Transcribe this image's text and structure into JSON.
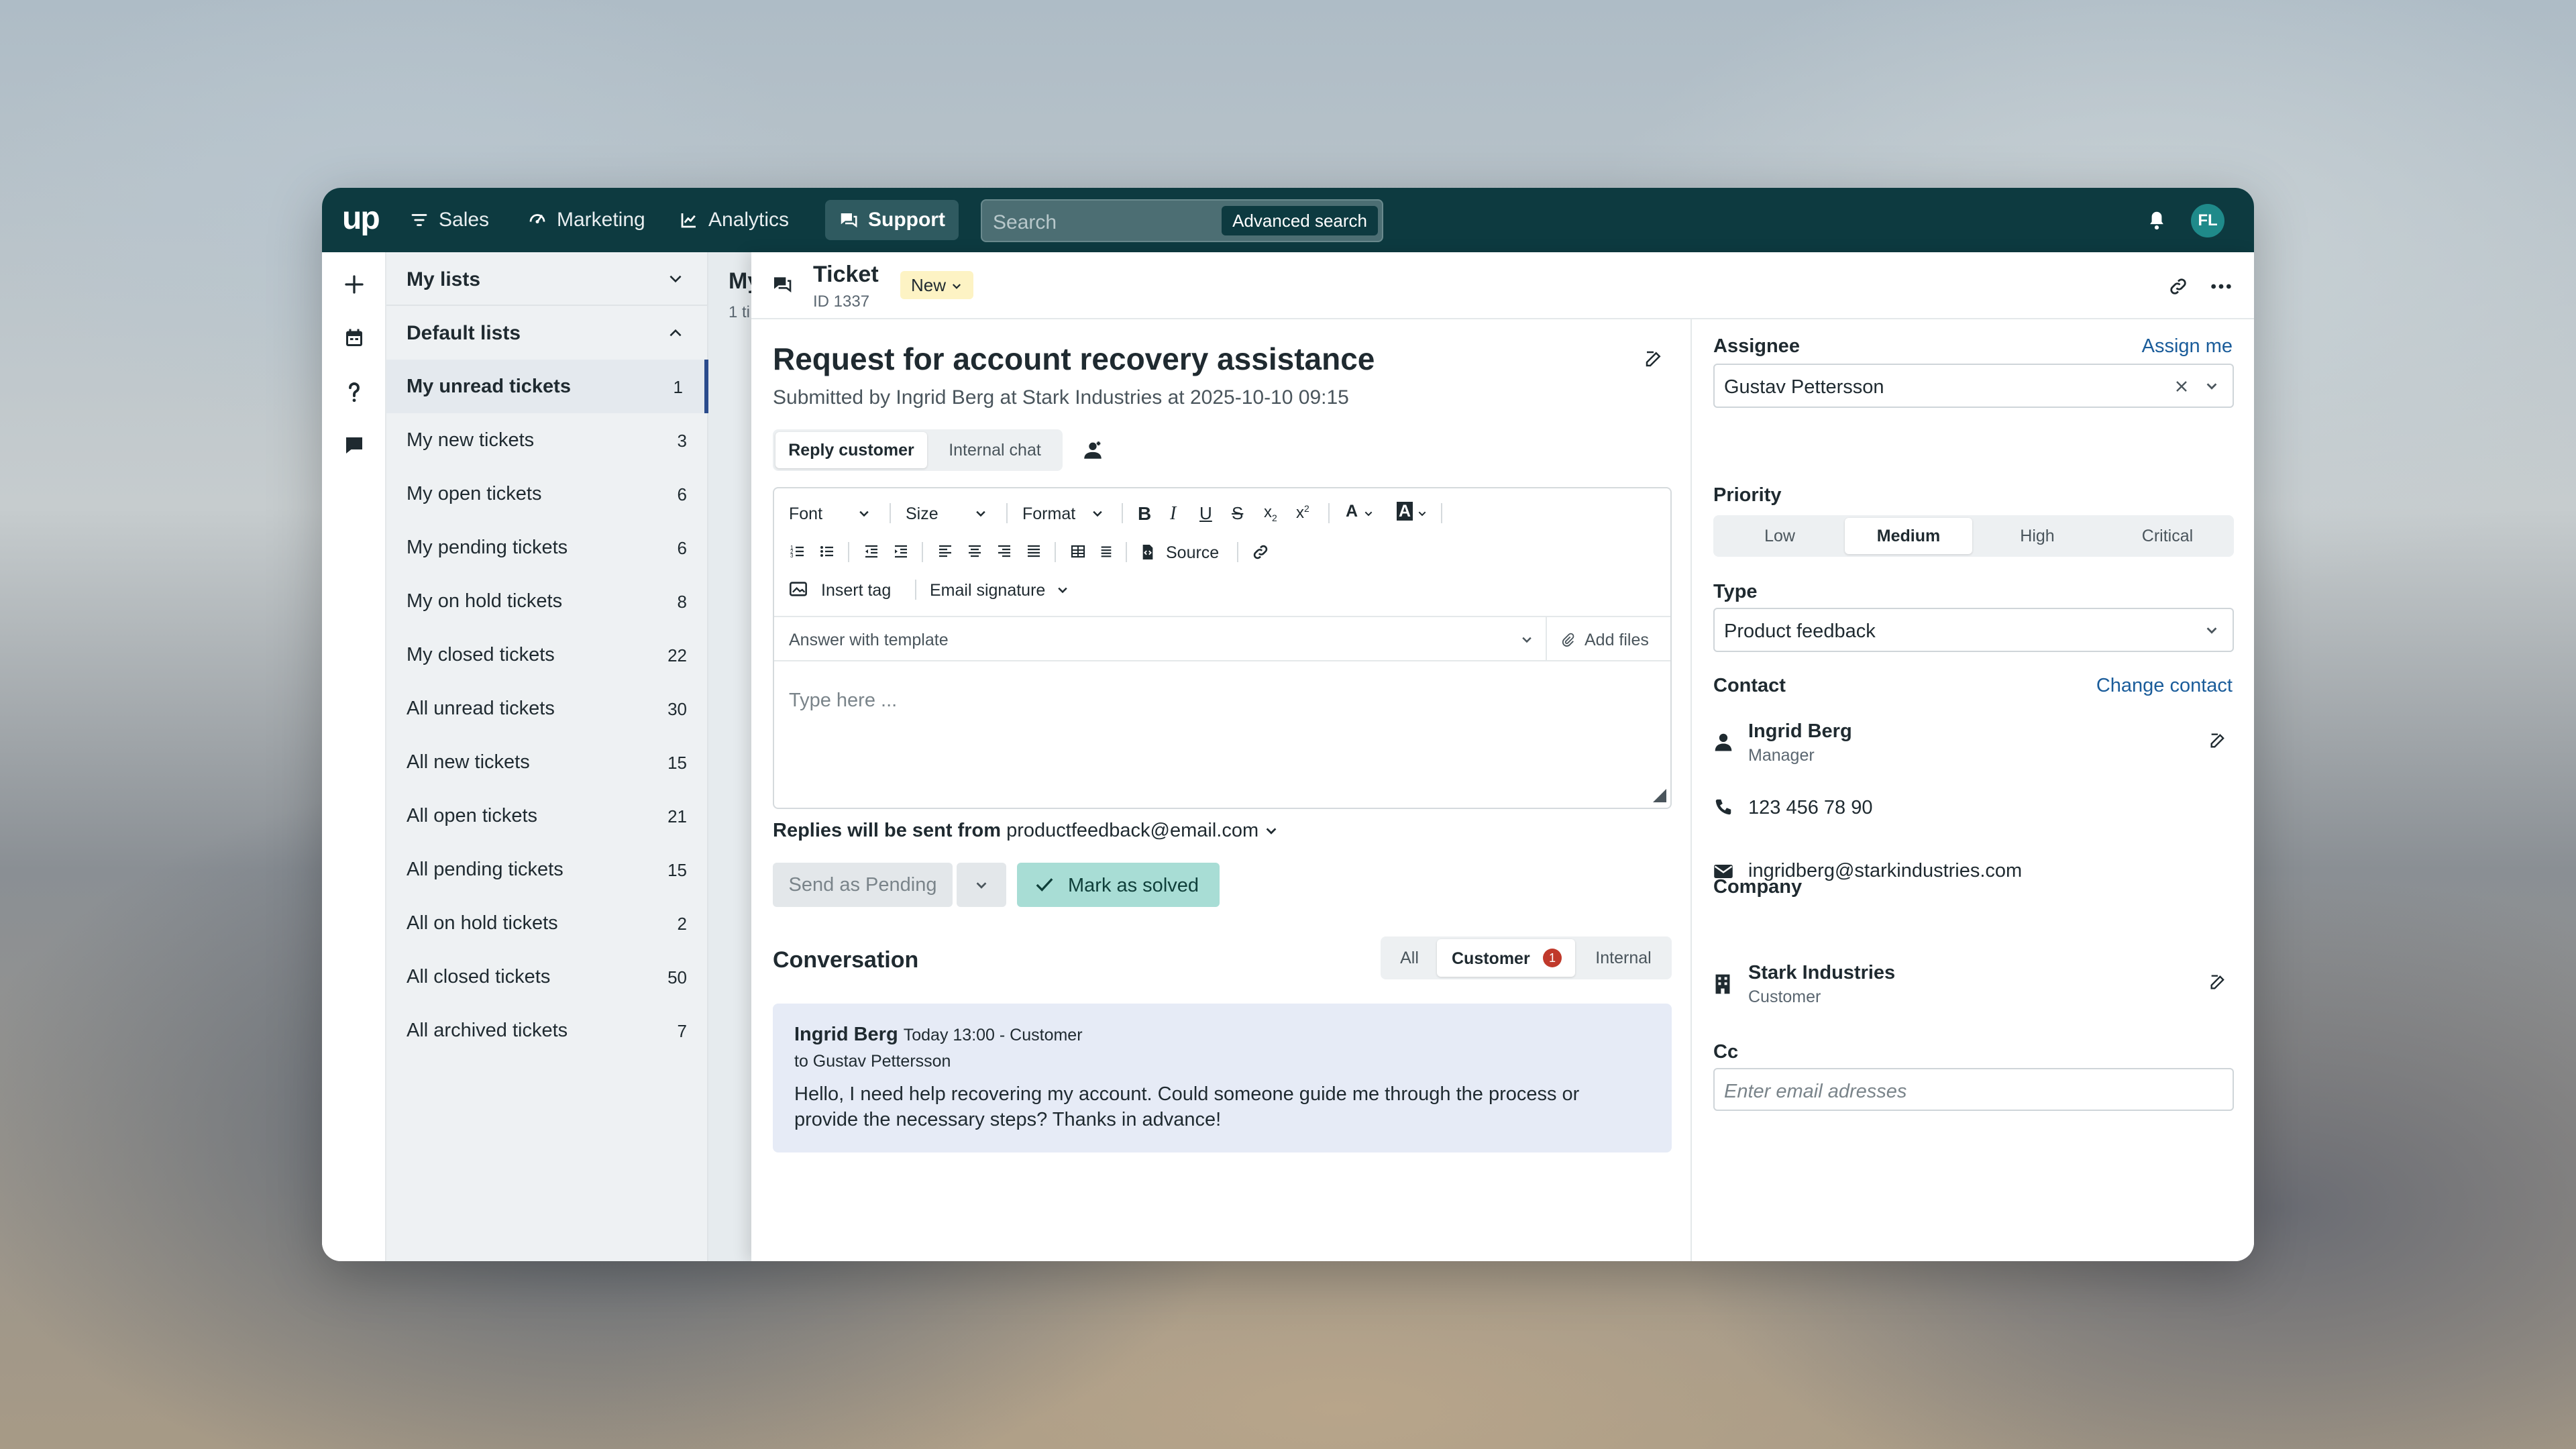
{
  "topbar": {
    "logo": "up",
    "nav": [
      {
        "label": "Sales",
        "icon": "filter-icon"
      },
      {
        "label": "Marketing",
        "icon": "megaphone-icon"
      },
      {
        "label": "Analytics",
        "icon": "chart-icon"
      },
      {
        "label": "Support",
        "icon": "chat-icon",
        "active": true
      }
    ],
    "search_placeholder": "Search",
    "advanced_search": "Advanced search",
    "avatar_initials": "FL"
  },
  "lists": {
    "my_lists": "My lists",
    "default_lists": "Default lists",
    "items": [
      {
        "label": "My unread tickets",
        "count": "1",
        "selected": true
      },
      {
        "label": "My new tickets",
        "count": "3"
      },
      {
        "label": "My open tickets",
        "count": "6"
      },
      {
        "label": "My pending tickets",
        "count": "6"
      },
      {
        "label": "My on hold tickets",
        "count": "8"
      },
      {
        "label": "My closed tickets",
        "count": "22"
      },
      {
        "label": "All unread tickets",
        "count": "30"
      },
      {
        "label": "All new tickets",
        "count": "15"
      },
      {
        "label": "All open tickets",
        "count": "21"
      },
      {
        "label": "All pending tickets",
        "count": "15"
      },
      {
        "label": "All on hold tickets",
        "count": "2"
      },
      {
        "label": "All closed tickets",
        "count": "50"
      },
      {
        "label": "All archived tickets",
        "count": "7"
      }
    ]
  },
  "background_list": {
    "title": "My",
    "subtitle": "1 ti"
  },
  "ticket": {
    "label": "Ticket",
    "id": "ID 1337",
    "status": "New",
    "title": "Request for account recovery assistance",
    "submitted": "Submitted by Ingrid Berg at Stark Industries at 2025-10-10 09:15",
    "tabs": [
      "Reply customer",
      "Internal chat"
    ],
    "toolbar": {
      "font": "Font",
      "size": "Size",
      "format": "Format",
      "source": "Source",
      "insert_tag": "Insert tag",
      "email_signature": "Email signature"
    },
    "template_placeholder": "Answer with template",
    "add_files": "Add files",
    "editor_placeholder": "Type here ...",
    "replies_from_label": "Replies will be sent from",
    "replies_from_email": "productfeedback@email.com",
    "send_pending": "Send as Pending",
    "mark_solved": "Mark as solved",
    "conversation": {
      "title": "Conversation",
      "filters": [
        "All",
        "Customer",
        "Internal"
      ],
      "customer_badge": "1",
      "message": {
        "author": "Ingrid Berg",
        "meta": "Today 13:00 - Customer",
        "to": "to Gustav Pettersson",
        "body": "Hello, I need help recovering my account. Could someone guide me through the process or provide the necessary steps? Thanks in advance!"
      }
    }
  },
  "sidebar": {
    "assignee_label": "Assignee",
    "assign_me": "Assign me",
    "assignee": "Gustav Pettersson",
    "priority_label": "Priority",
    "priorities": [
      "Low",
      "Medium",
      "High",
      "Critical"
    ],
    "priority_selected": "Medium",
    "type_label": "Type",
    "type": "Product feedback",
    "contact_label": "Contact",
    "change_contact": "Change contact",
    "contact_name": "Ingrid Berg",
    "contact_role": "Manager",
    "phone": "123 456 78 90",
    "email": "ingridberg@starkindustries.com",
    "company_label": "Company",
    "company_name": "Stark Industries",
    "company_role": "Customer",
    "cc_label": "Cc",
    "cc_placeholder": "Enter email adresses"
  },
  "colors": {
    "topbar": "#0d3a40",
    "accent": "#1a5c9a",
    "solve": "#a8ddd5",
    "badge": "#c0392b"
  }
}
